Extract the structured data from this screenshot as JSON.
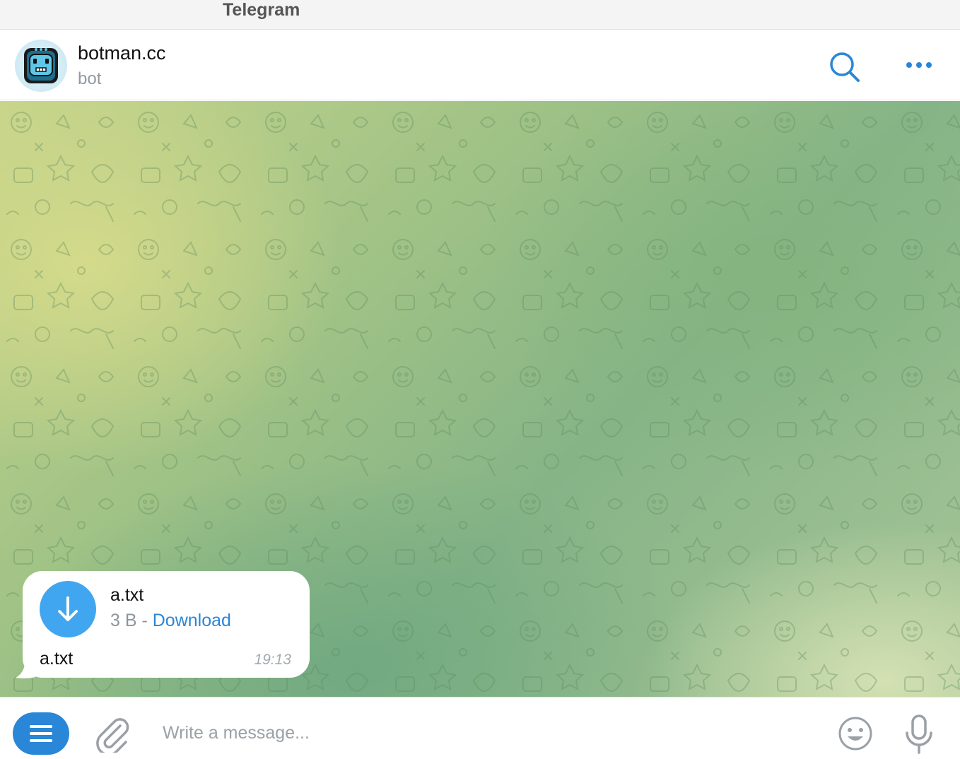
{
  "window": {
    "title": "Telegram"
  },
  "chat": {
    "name": "botman.cc",
    "status": "bot"
  },
  "message": {
    "file_name": "a.txt",
    "file_size": "3 B",
    "separator": " - ",
    "download_label": "Download",
    "caption": "a.txt",
    "time": "19:13"
  },
  "composer": {
    "placeholder": "Write a message..."
  },
  "colors": {
    "accent": "#2a86d6",
    "download_button": "#40a6f0",
    "bubble": "#ffffff"
  },
  "icons": {
    "header": [
      "search-icon",
      "more-icon"
    ],
    "message": [
      "download-icon"
    ],
    "composer": [
      "menu-icon",
      "paperclip-icon",
      "emoji-icon",
      "microphone-icon"
    ]
  }
}
